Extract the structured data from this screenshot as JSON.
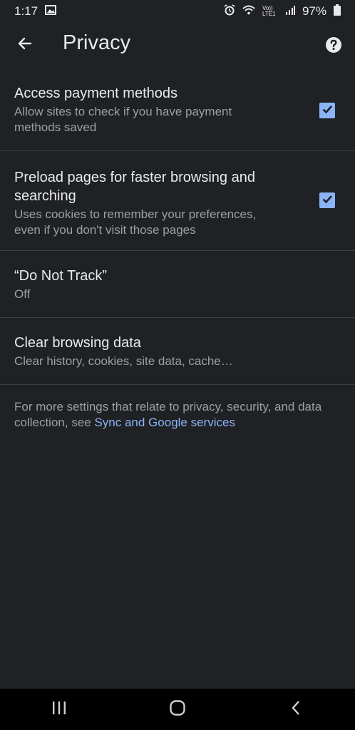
{
  "status": {
    "time": "1:17",
    "battery": "97%",
    "net_label": "Vo)) LTE1"
  },
  "header": {
    "title": "Privacy"
  },
  "settings": [
    {
      "title": "Access payment methods",
      "subtitle": "Allow sites to check if you have payment methods saved",
      "checked": true
    },
    {
      "title": "Preload pages for faster browsing and searching",
      "subtitle": "Uses cookies to remember your preferences, even if you don't visit those pages",
      "checked": true
    },
    {
      "title": "“Do Not Track”",
      "subtitle": "Off"
    },
    {
      "title": "Clear browsing data",
      "subtitle": "Clear history, cookies, site data, cache…"
    }
  ],
  "footer": {
    "text": "For more settings that relate to privacy, security, and data collection, see ",
    "link": "Sync and Google services"
  },
  "colors": {
    "background": "#202124",
    "accent": "#8ab4f8",
    "secondary_text": "#9aa0a6"
  },
  "icons": {
    "back": "arrow-back-icon",
    "help": "help-icon",
    "nav_recents": "recents-icon",
    "nav_home": "home-icon",
    "nav_back": "nav-back-icon"
  }
}
